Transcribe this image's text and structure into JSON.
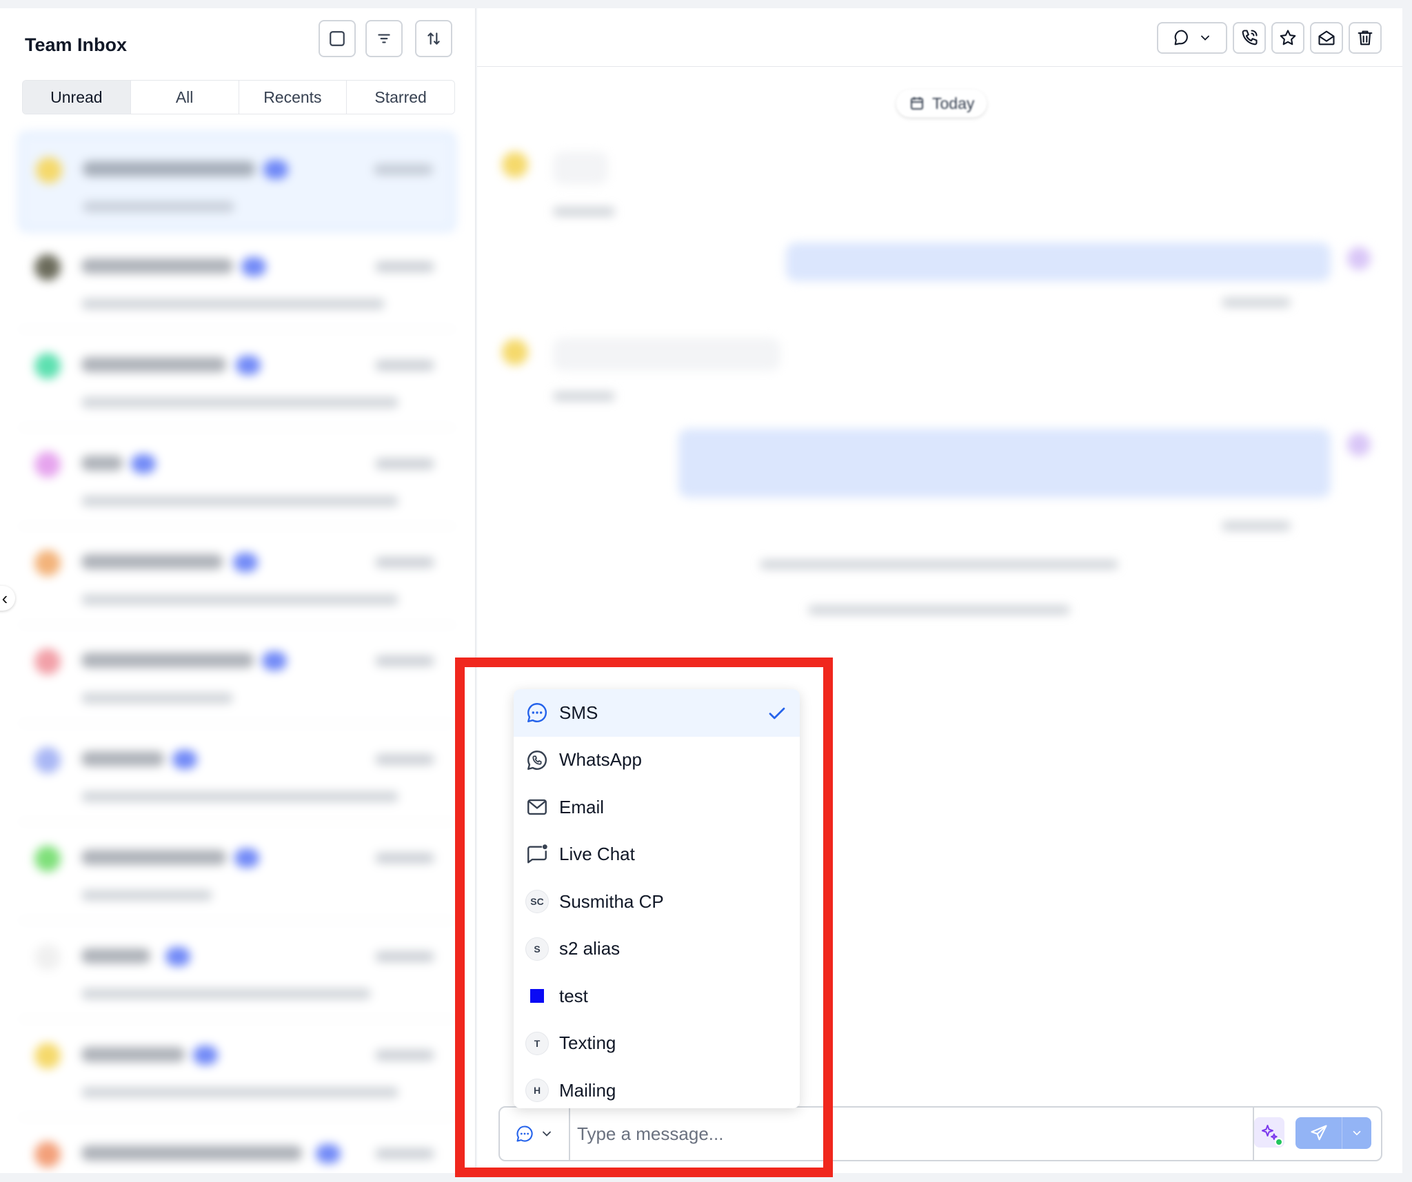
{
  "inbox": {
    "title": "Team Inbox",
    "tabs": [
      {
        "label": "Unread",
        "active": true
      },
      {
        "label": "All",
        "active": false
      },
      {
        "label": "Recents",
        "active": false
      },
      {
        "label": "Starred",
        "active": false
      }
    ]
  },
  "chat": {
    "date_divider": "Today"
  },
  "composer": {
    "placeholder": "Type a message..."
  },
  "channel_menu": {
    "selected": "SMS",
    "items": [
      {
        "label": "SMS",
        "icon": "sms-icon",
        "selected": true
      },
      {
        "label": "WhatsApp",
        "icon": "whatsapp-icon",
        "selected": false
      },
      {
        "label": "Email",
        "icon": "email-icon",
        "selected": false
      },
      {
        "label": "Live Chat",
        "icon": "live-chat-icon",
        "selected": false
      },
      {
        "label": "Susmitha CP",
        "initials": "SC",
        "selected": false
      },
      {
        "label": "s2 alias",
        "initials": "S",
        "selected": false
      },
      {
        "label": "test",
        "color": "#0a0af5",
        "selected": false
      },
      {
        "label": "Texting",
        "initials": "T",
        "selected": false
      },
      {
        "label": "Mailing",
        "initials": "H",
        "selected": false
      }
    ]
  },
  "colors": {
    "highlight": "#f0271d",
    "accent": "#2563eb",
    "selected_row": "#eef5ff"
  }
}
